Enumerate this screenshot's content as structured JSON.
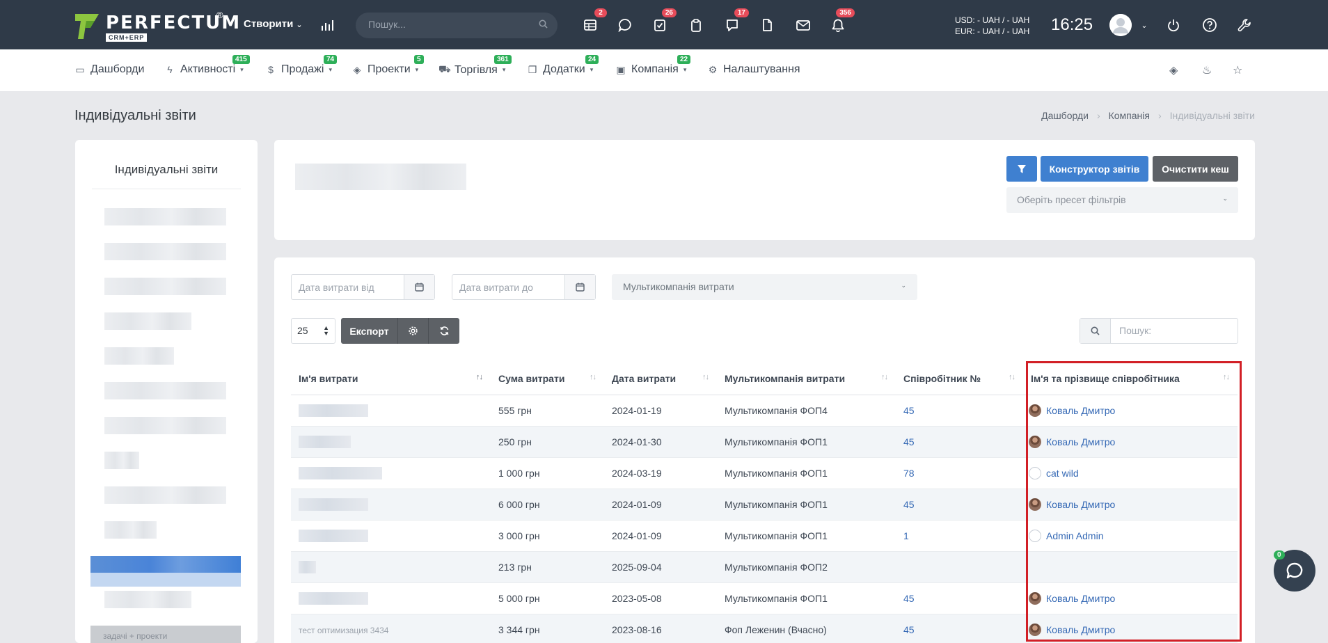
{
  "topbar": {
    "logo": {
      "name": "PERFECTUM",
      "reg": "®",
      "sub": "CRM+ERP"
    },
    "create_label": "Створити",
    "search_placeholder": "Пошук...",
    "icons": [
      {
        "name": "table-icon",
        "badge": "2"
      },
      {
        "name": "chat-icon",
        "badge": ""
      },
      {
        "name": "tasks-icon",
        "badge": "26"
      },
      {
        "name": "clipboard-icon",
        "badge": ""
      },
      {
        "name": "messages-icon",
        "badge": "17"
      },
      {
        "name": "document-icon",
        "badge": ""
      },
      {
        "name": "mail-icon",
        "badge": ""
      },
      {
        "name": "bell-icon",
        "badge": "356"
      }
    ],
    "currency_usd": "USD: - UAH / - UAH",
    "currency_eur": "EUR: - UAH / - UAH",
    "time": "16:25"
  },
  "nav": {
    "items": [
      {
        "label": "Дашборди",
        "badge": ""
      },
      {
        "label": "Активності",
        "badge": "415"
      },
      {
        "label": "Продажі",
        "badge": "74"
      },
      {
        "label": "Проекти",
        "badge": "5"
      },
      {
        "label": "Торгівля",
        "badge": "361"
      },
      {
        "label": "Додатки",
        "badge": "24"
      },
      {
        "label": "Компанія",
        "badge": "22"
      },
      {
        "label": "Налаштування",
        "badge": ""
      }
    ]
  },
  "page": {
    "title": "Індивідуальні звіти",
    "breadcrumb": [
      "Дашборди",
      "Компанія",
      "Індивідуальні звіти"
    ]
  },
  "sidebar": {
    "title": "Індивідуальні звіти",
    "bottom_item": "задачі + проекти"
  },
  "toolbar": {
    "report_builder": "Конструктор звітів",
    "clear_cache": "Очистити кеш",
    "preset_placeholder": "Оберіть пресет фільтрів"
  },
  "filters": {
    "date_from": "Дата витрати від",
    "date_to": "Дата витрати до",
    "multicompany": "Мультикомпанія витрати"
  },
  "table_controls": {
    "page_size": "25",
    "export": "Експорт",
    "search_placeholder": "Пошук:"
  },
  "table": {
    "columns": [
      "Ім'я витрати",
      "Сума витрати",
      "Дата витрати",
      "Мультикомпанія витрати",
      "Співробітник №",
      "Ім'я та прізвище співробітника"
    ],
    "rows": [
      {
        "name": "",
        "amount": "555 грн",
        "date": "2024-01-19",
        "company": "Мультикомпанія ФОП4",
        "emp_no": "45",
        "employee": "Коваль Дмитро",
        "avatar": "photo"
      },
      {
        "name": "",
        "amount": "250 грн",
        "date": "2024-01-30",
        "company": "Мультикомпанія ФОП1",
        "emp_no": "45",
        "employee": "Коваль Дмитро",
        "avatar": "photo"
      },
      {
        "name": "",
        "amount": "1 000 грн",
        "date": "2024-03-19",
        "company": "Мультикомпанія ФОП1",
        "emp_no": "78",
        "employee": "cat wild",
        "avatar": "blank"
      },
      {
        "name": "",
        "amount": "6 000 грн",
        "date": "2024-01-09",
        "company": "Мультикомпанія ФОП1",
        "emp_no": "45",
        "employee": "Коваль Дмитро",
        "avatar": "photo"
      },
      {
        "name": "",
        "amount": "3 000 грн",
        "date": "2024-01-09",
        "company": "Мультикомпанія ФОП1",
        "emp_no": "1",
        "employee": "Admin Admin",
        "avatar": "blank"
      },
      {
        "name": "",
        "amount": "213 грн",
        "date": "2025-09-04",
        "company": "Мультикомпанія ФОП2",
        "emp_no": "",
        "employee": "",
        "avatar": ""
      },
      {
        "name": "",
        "amount": "5 000 грн",
        "date": "2023-05-08",
        "company": "Мультикомпанія ФОП1",
        "emp_no": "45",
        "employee": "Коваль Дмитро",
        "avatar": "photo"
      },
      {
        "name": "тест оптимизация 3434",
        "amount": "3 344 грн",
        "date": "2023-08-16",
        "company": "Фоп Леженин (Вчасно)",
        "emp_no": "45",
        "employee": "Коваль Дмитро",
        "avatar": "photo"
      }
    ]
  },
  "chat": {
    "badge": "0"
  },
  "colors": {
    "accent": "#3f80d0",
    "highlight": "#d21f26",
    "topbar": "#2f3a48",
    "badge_red": "#e74c5a",
    "badge_green": "#2eaf59"
  }
}
